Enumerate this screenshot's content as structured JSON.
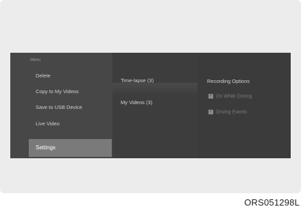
{
  "menu": {
    "title": "Menu",
    "items": [
      {
        "label": "Delete"
      },
      {
        "label": "Copy to My Videos"
      },
      {
        "label": "Save to USB Device"
      },
      {
        "label": "Live Video"
      },
      {
        "label": "Settings",
        "selected": true
      }
    ]
  },
  "folders": [
    {
      "label": "Time-lapse (3)"
    },
    {
      "label": "My Videos (3)"
    }
  ],
  "recording_options": {
    "title": "Recording Options",
    "items": [
      {
        "label": "On While Driving",
        "checked": true
      },
      {
        "label": "Driving Events",
        "checked": true
      }
    ]
  },
  "caption": "ORS051298L",
  "colors": {
    "sidebar": "#474747",
    "selected": "#7a7a7a",
    "screen": "#3b3b3b"
  }
}
